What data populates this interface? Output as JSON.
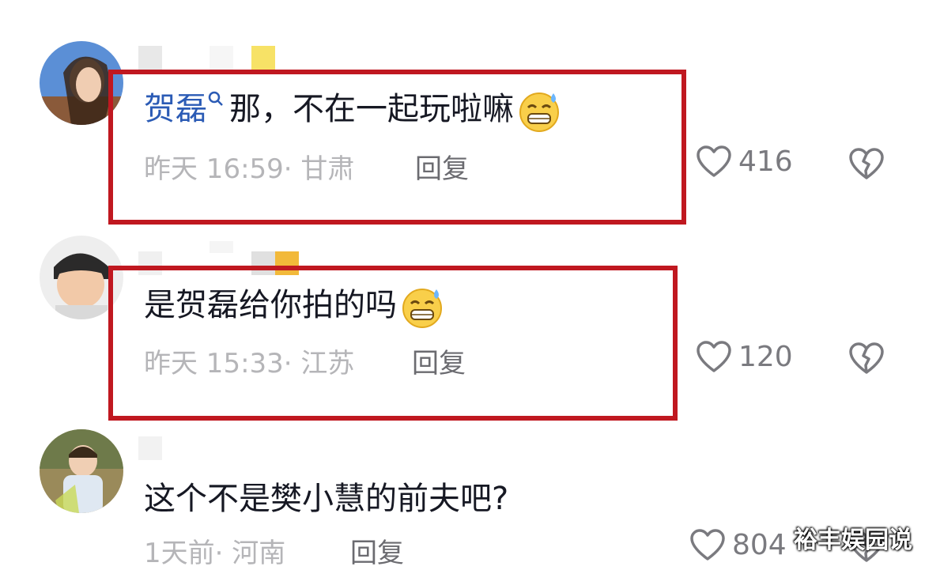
{
  "comments": [
    {
      "mention": "贺磊",
      "text": "那，不在一起玩啦嘛",
      "time": "昨天 16:59",
      "location": "· 甘肃",
      "reply": "回复",
      "likes": "416",
      "avatar_icon": "woman-portrait-avatar",
      "emoji": "sweat-grin-emoji"
    },
    {
      "text": "是贺磊给你拍的吗",
      "time": "昨天 15:33",
      "location": "· 江苏",
      "reply": "回复",
      "likes": "120",
      "avatar_icon": "boy-portrait-avatar",
      "emoji": "sweat-grin-emoji"
    },
    {
      "text": "这个不是樊小慧的前夫吧?",
      "time": "1天前",
      "location": "· 河南",
      "reply": "回复",
      "likes": "804",
      "avatar_icon": "child-outdoor-avatar"
    }
  ],
  "watermark": "裕丰娱园说",
  "colors": {
    "highlight": "#c01820",
    "mention": "#2b5bb5",
    "text": "#161823",
    "meta": "#b5b5b8"
  }
}
